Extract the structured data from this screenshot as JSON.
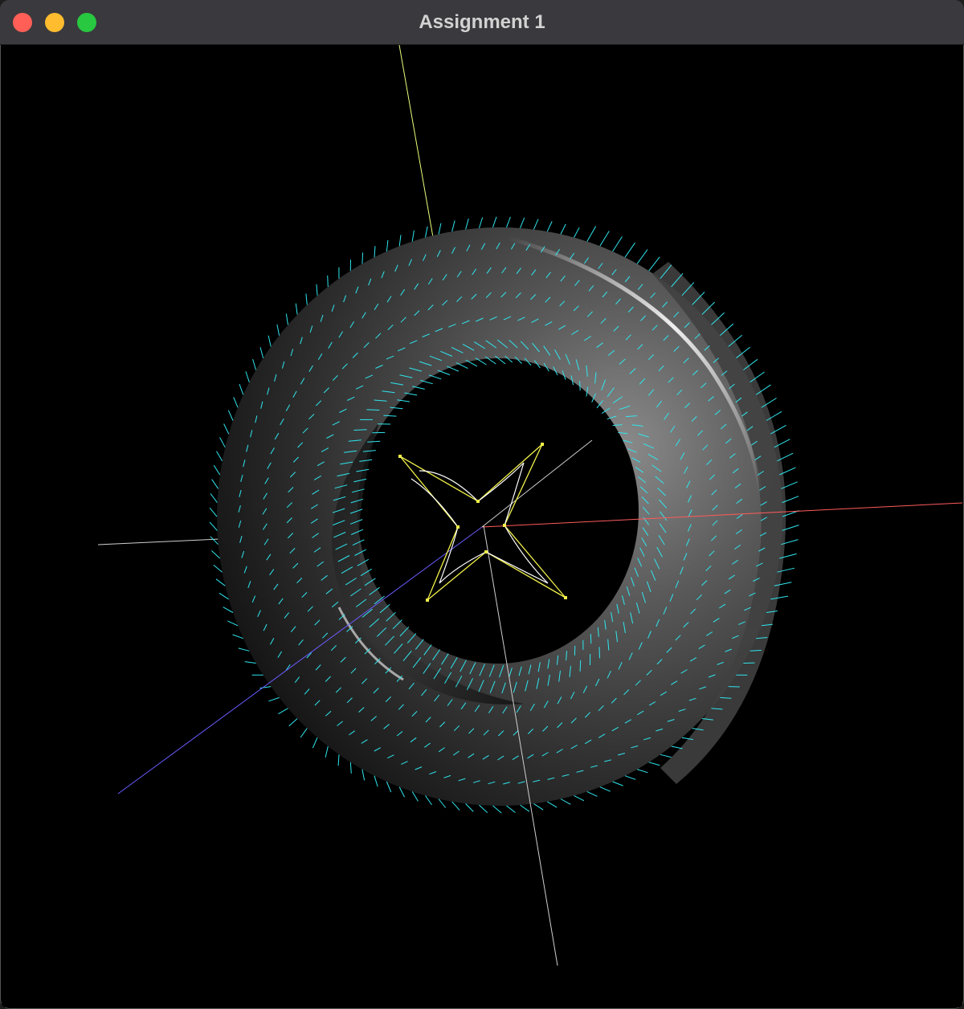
{
  "window": {
    "title": "Assignment 1",
    "buttons": [
      "close",
      "minimize",
      "zoom"
    ]
  },
  "scene": {
    "background": "#000000",
    "surface": "torus",
    "surface_color": "#9a9a9a",
    "normal_color": "#2fe6ee",
    "curve_color": "#f2f24a",
    "axes": {
      "x_color": "#ff5a5a",
      "y_color": "#e8ff7a",
      "z_color": "#6a5cff"
    }
  }
}
